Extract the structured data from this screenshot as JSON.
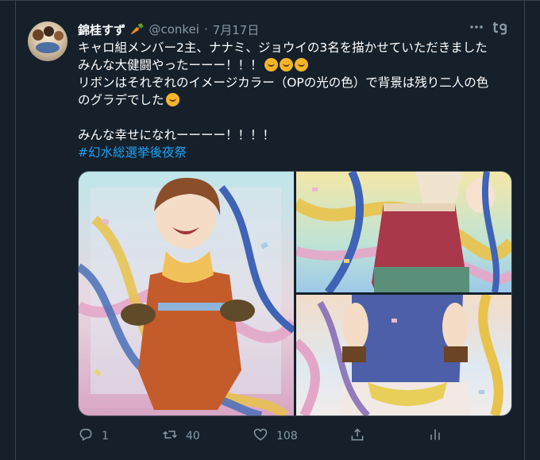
{
  "tweet": {
    "author_name": "錦桂すず",
    "handle": "@conkei",
    "separator": "·",
    "date": "7月17日",
    "lines": [
      "キャロ組メンバー2主、ナナミ、ジョウイの3名を描かせていただきました",
      "みんな大健闘やったーーー！！！",
      "リボンはそれぞれのイメージカラー（OPの光の色）で背景は残り二人の色",
      "のグラデでした",
      "みんな幸せになれーーーー！！！！"
    ],
    "hashtag": "#幻水総選挙後夜祭"
  },
  "icons": {
    "carrot": "🥕",
    "party_emoji": "party-face",
    "love_emoji": "smiling-face-with-hearts",
    "more": "more-dots-icon",
    "app_badge": "tg"
  },
  "actions": {
    "reply_count": "1",
    "retweet_count": "40",
    "like_count": "108"
  },
  "colors": {
    "background": "#15202b",
    "text": "#ffffff",
    "muted": "#8899a6",
    "link": "#1da1f2",
    "border": "#38444d"
  }
}
